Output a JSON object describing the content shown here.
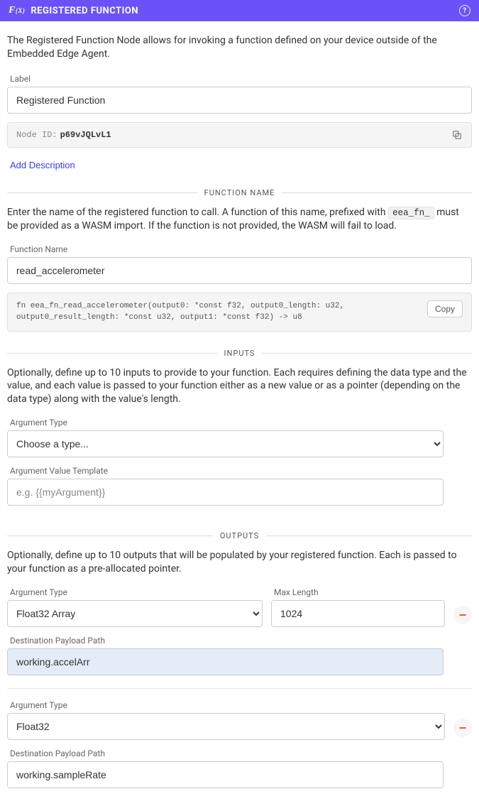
{
  "header": {
    "icon_text": "f",
    "icon_sub": "(x)",
    "title": "REGISTERED FUNCTION"
  },
  "intro": "The Registered Function Node allows for invoking a function defined on your device outside of the Embedded Edge Agent.",
  "label": {
    "field_label": "Label",
    "value": "Registered Function"
  },
  "node_id": {
    "label": "Node ID: ",
    "value": "p69vJQLvL1"
  },
  "add_description": "Add Description",
  "function_name_section": {
    "title": "FUNCTION NAME",
    "help_before": "Enter the name of the registered function to call. A function of this name, prefixed with ",
    "help_code": "eea_fn_",
    "help_after": " must be provided as a WASM import. If the function is not provided, the WASM will fail to load.",
    "field_label": "Function Name",
    "value": "read_accelerometer",
    "signature": "fn eea_fn_read_accelerometer(output0: *const f32, output0_length: u32, output0_result_length: *const u32, output1: *const f32) -> u8",
    "copy_label": "Copy"
  },
  "inputs_section": {
    "title": "INPUTS",
    "help": "Optionally, define up to 10 inputs to provide to your function. Each requires defining the data type and the value, and each value is passed to your function either as a new value or as a pointer (depending on the data type) along with the value's length.",
    "arg_type_label": "Argument Type",
    "arg_type_value": "Choose a type...",
    "arg_value_label": "Argument Value Template",
    "arg_value_placeholder": "e.g. {{myArgument}}"
  },
  "outputs_section": {
    "title": "OUTPUTS",
    "help": "Optionally, define up to 10 outputs that will be populated by your registered function. Each is passed to your function as a pre-allocated pointer.",
    "arg_type_label": "Argument Type",
    "max_length_label": "Max Length",
    "dest_label": "Destination Payload Path",
    "rows": [
      {
        "type": "Float32 Array",
        "max_length": "1024",
        "dest": "working.accelArr",
        "has_maxlen": true,
        "highlight": true
      },
      {
        "type": "Float32",
        "dest": "working.sampleRate",
        "has_maxlen": false,
        "highlight": false
      }
    ]
  }
}
